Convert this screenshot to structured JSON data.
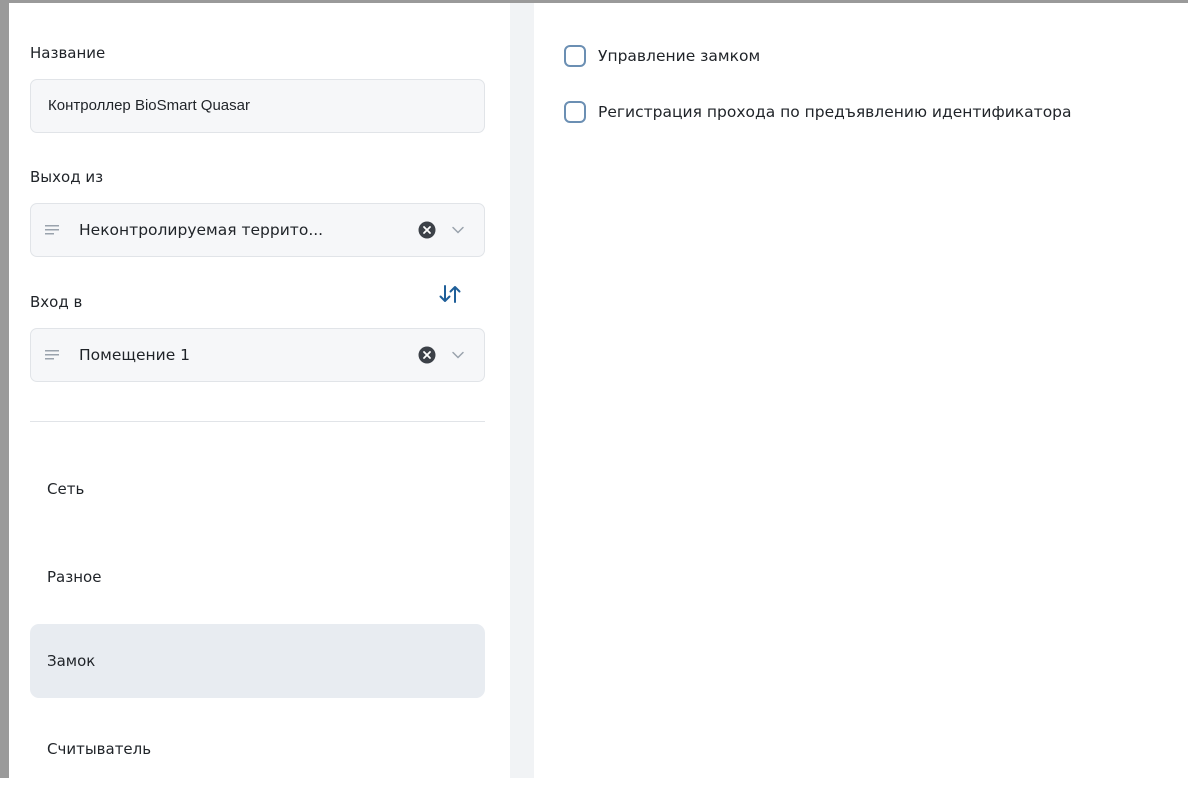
{
  "form": {
    "name_label": "Название",
    "name_value": "Контроллер BioSmart Quasar",
    "exit_label": "Выход из",
    "exit_value": "Неконтролируемая террито...",
    "entry_label": "Вход в",
    "entry_value": "Помещение 1"
  },
  "nav": {
    "items": [
      {
        "label": "Сеть",
        "active": false
      },
      {
        "label": "Разное",
        "active": false
      },
      {
        "label": "Замок",
        "active": true
      },
      {
        "label": "Считыватель",
        "active": false
      }
    ]
  },
  "lock_settings": {
    "options": [
      {
        "label": "Управление замком",
        "checked": false
      },
      {
        "label": "Регистрация прохода по предъявлению идентификатора",
        "checked": false
      }
    ]
  },
  "icons": {
    "select_list": "lines-icon",
    "clear": "clear-icon",
    "dropdown": "chevron-down-icon",
    "swap": "swap-direction-icon"
  },
  "colors": {
    "accent": "#1f5f99",
    "active_nav_bg": "#e8ecf1",
    "checkbox_border": "#6b8fb3"
  }
}
